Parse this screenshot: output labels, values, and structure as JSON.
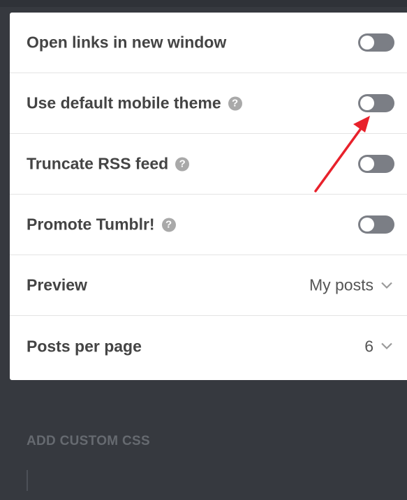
{
  "settings": {
    "rows": [
      {
        "label": "Open links in new window",
        "control": "toggle",
        "on": false,
        "help": false
      },
      {
        "label": "Use default mobile theme",
        "control": "toggle",
        "on": false,
        "help": true
      },
      {
        "label": "Truncate RSS feed",
        "control": "toggle",
        "on": false,
        "help": true
      },
      {
        "label": "Promote Tumblr!",
        "control": "toggle",
        "on": false,
        "help": true
      },
      {
        "label": "Preview",
        "control": "select",
        "value": "My posts"
      },
      {
        "label": "Posts per page",
        "control": "select",
        "value": "6"
      }
    ],
    "help_glyph": "?"
  },
  "custom_css": {
    "title": "ADD CUSTOM CSS"
  },
  "colors": {
    "panel_bg": "#ffffff",
    "page_bg": "#36393f",
    "toggle_off": "#7b7e85",
    "annotation_arrow": "#e8212b"
  },
  "icons": {
    "help": "question-circle-icon",
    "select": "chevron-down-icon"
  }
}
